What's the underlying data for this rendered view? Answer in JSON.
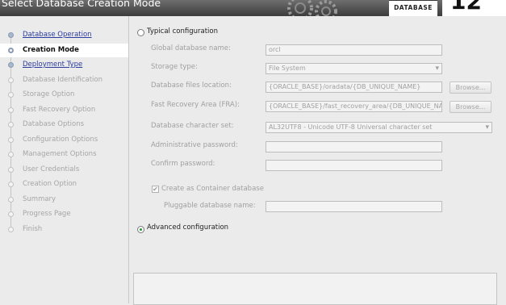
{
  "header": {
    "title": "Select Database Creation Mode",
    "product_label": "DATABASE",
    "version": "12"
  },
  "nav": {
    "items": [
      {
        "label": "Database Operation",
        "state": "done"
      },
      {
        "label": "Creation Mode",
        "state": "current"
      },
      {
        "label": "Deployment Type",
        "state": "done"
      },
      {
        "label": "Database Identification",
        "state": "pending"
      },
      {
        "label": "Storage Option",
        "state": "pending"
      },
      {
        "label": "Fast Recovery Option",
        "state": "pending"
      },
      {
        "label": "Database Options",
        "state": "pending"
      },
      {
        "label": "Configuration Options",
        "state": "pending"
      },
      {
        "label": "Management Options",
        "state": "pending"
      },
      {
        "label": "User Credentials",
        "state": "pending"
      },
      {
        "label": "Creation Option",
        "state": "pending"
      },
      {
        "label": "Summary",
        "state": "pending"
      },
      {
        "label": "Progress Page",
        "state": "pending"
      },
      {
        "label": "Finish",
        "state": "pending"
      }
    ]
  },
  "typical": {
    "label": "Typical configuration",
    "selected": false,
    "global_db_name": {
      "label": "Global database name:",
      "value": "orcl"
    },
    "storage_type": {
      "label": "Storage type:",
      "value": "File System"
    },
    "db_files_location": {
      "label": "Database files location:",
      "value": "{ORACLE_BASE}/oradata/{DB_UNIQUE_NAME}"
    },
    "fra": {
      "label": "Fast Recovery Area (FRA):",
      "value": "{ORACLE_BASE}/fast_recovery_area/{DB_UNIQUE_NAME}"
    },
    "charset": {
      "label": "Database character set:",
      "value": "AL32UTF8 - Unicode UTF-8 Universal character set"
    },
    "admin_password": {
      "label": "Administrative password:",
      "value": ""
    },
    "confirm_password": {
      "label": "Confirm password:",
      "value": ""
    },
    "container_db": {
      "label": "Create as Container database",
      "checked": true
    },
    "pluggable_db_name": {
      "label": "Pluggable database name:",
      "value": ""
    },
    "browse_label": "Browse...",
    "checkmark": "✔"
  },
  "advanced": {
    "label": "Advanced configuration",
    "selected": true
  },
  "colors": {
    "link": "#2a3b9c",
    "radio_selected": "#1f9a3a",
    "disabled_text": "#a0a0a0"
  }
}
